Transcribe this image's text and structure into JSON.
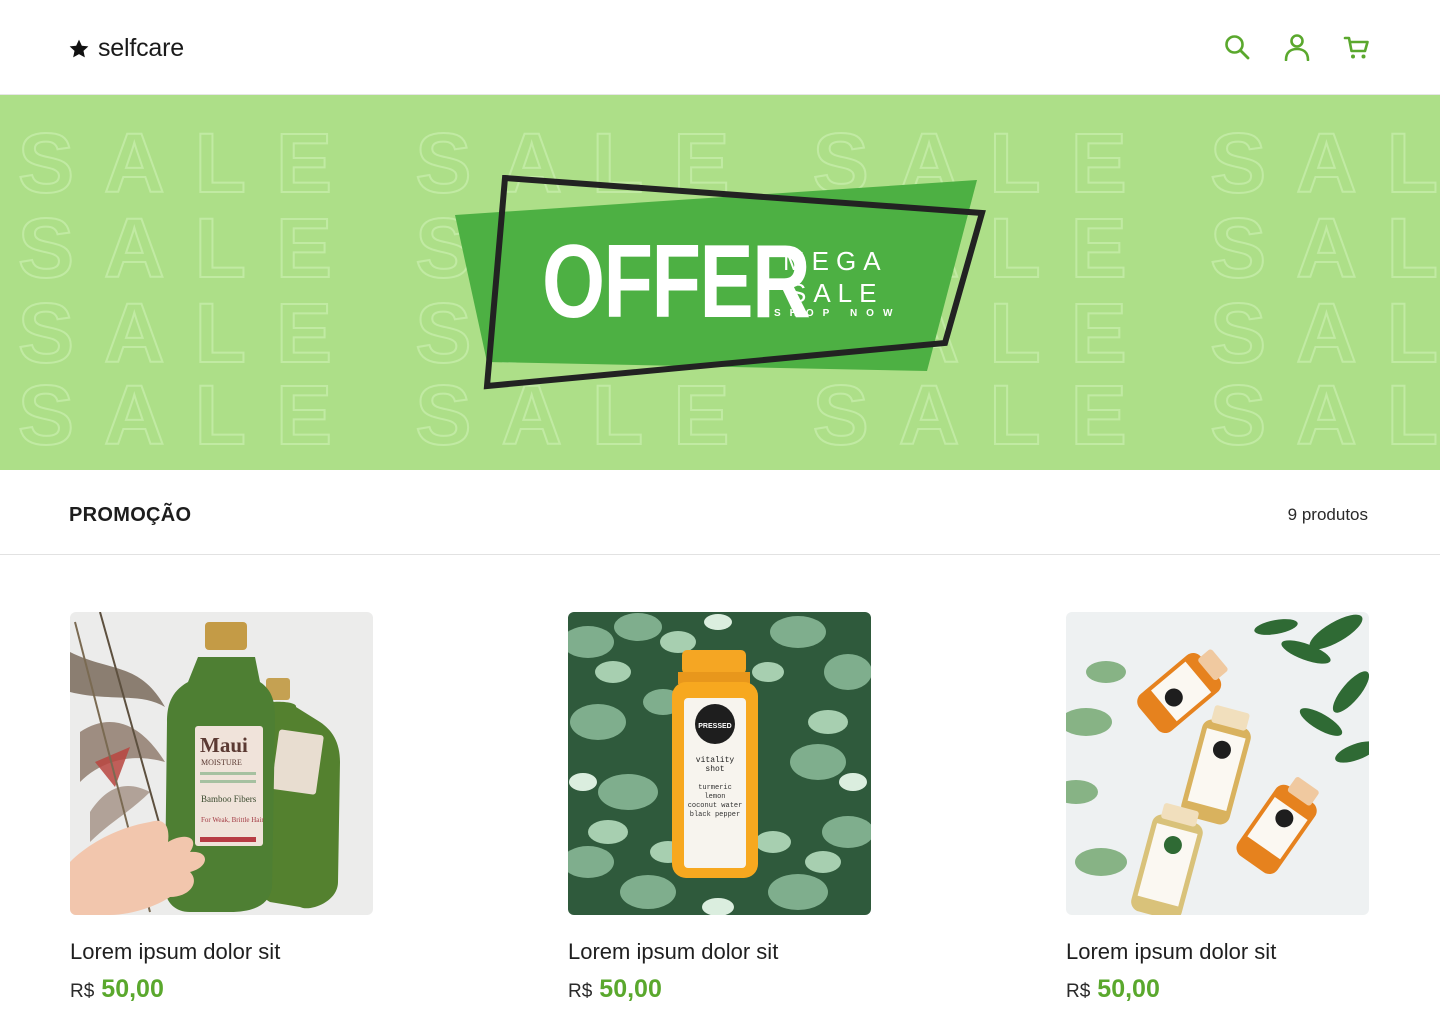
{
  "brand": {
    "name": "selfcare",
    "icon": "star-icon"
  },
  "header": {
    "icons": [
      "search-icon",
      "user-icon",
      "cart-icon"
    ],
    "accent_color": "#5aa82d"
  },
  "banner": {
    "background_color": "#addf88",
    "pattern_word": "SALE",
    "offer": "OFFER",
    "mega": "MEGA",
    "sale": "SALE",
    "shop_now": "SHOP NOW",
    "badge_color": "#4db043"
  },
  "section": {
    "title": "PROMOÇÃO",
    "count": "9 produtos"
  },
  "products": [
    {
      "name": "Lorem ipsum dolor sit",
      "currency": "R$",
      "price": "50,00",
      "image": "green-shampoo-bottle"
    },
    {
      "name": "Lorem ipsum dolor sit",
      "currency": "R$",
      "price": "50,00",
      "image": "orange-juice-bottle-in-leaves"
    },
    {
      "name": "Lorem ipsum dolor sit",
      "currency": "R$",
      "price": "50,00",
      "image": "four-juice-shots"
    }
  ]
}
